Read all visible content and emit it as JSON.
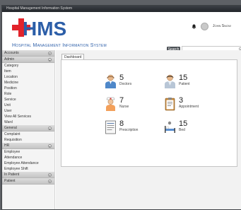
{
  "window": {
    "title": "Hospital Management Information System"
  },
  "header": {
    "logo_text": "HMS",
    "subtitle": "Hospital Management Information System",
    "user_name": "John Snow",
    "search_label": "Search",
    "search_placeholder": "",
    "search_go": "G"
  },
  "sidebar": {
    "groups": [
      {
        "title": "Accounts",
        "items": []
      },
      {
        "title": "Admin",
        "items": [
          "Category",
          "Item",
          "Location",
          "Medicine",
          "Position",
          "Role",
          "Service",
          "Unit",
          "User",
          "View All Services",
          "Ward"
        ]
      },
      {
        "title": "General",
        "items": [
          "Complaint",
          "Requisition"
        ]
      },
      {
        "title": "HR",
        "items": [
          "Employee",
          "Attendance",
          "Employee Attendance",
          "Employee Shift"
        ]
      },
      {
        "title": "In Patient",
        "items": []
      },
      {
        "title": "Patient",
        "items": []
      }
    ]
  },
  "content": {
    "tab_label": "Dashboard",
    "stats": [
      {
        "value": "5",
        "label": "Doctors",
        "icon": "doctor-icon"
      },
      {
        "value": "15",
        "label": "Patient",
        "icon": "patient-icon"
      },
      {
        "value": "7",
        "label": "Nurse",
        "icon": "nurse-icon"
      },
      {
        "value": "3",
        "label": "Appointment",
        "icon": "appointment-icon"
      },
      {
        "value": "8",
        "label": "Prescription",
        "icon": "prescription-icon"
      },
      {
        "value": "15",
        "label": "Bed",
        "icon": "bed-icon"
      }
    ]
  },
  "colors": {
    "brand_red": "#e2232b",
    "brand_blue": "#2c5ea8",
    "titlebar": "#2b2e33"
  }
}
